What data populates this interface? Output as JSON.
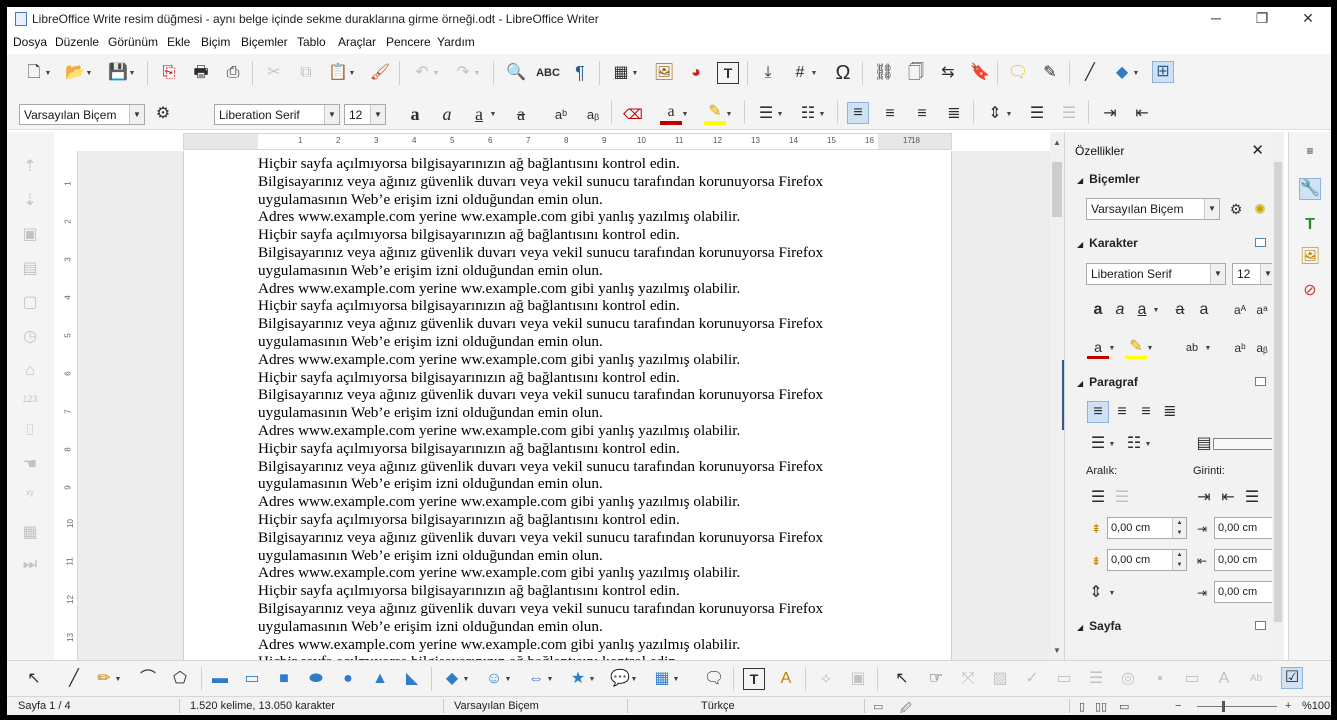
{
  "window": {
    "title": "LibreOffice Write resim düğmesi - aynı belge içinde sekme duraklarına girme örneği.odt - LibreOffice Writer",
    "minimize": "─",
    "maximize": "❐",
    "close": "✕"
  },
  "menu": [
    "Dosya",
    "Düzenle",
    "Görünüm",
    "Ekle",
    "Biçim",
    "Biçemler",
    "Tablo",
    "Araçlar",
    "Pencere",
    "Yardım"
  ],
  "formatting": {
    "paragraph_style": "Varsayılan Biçem",
    "font_name": "Liberation Serif",
    "font_size": "12"
  },
  "ruler": {
    "numbers": [
      "1",
      "2",
      "3",
      "4",
      "5",
      "6",
      "7",
      "8",
      "9",
      "10",
      "11",
      "12",
      "13",
      "14",
      "15",
      "16",
      "17",
      "18"
    ],
    "vertical_numbers": [
      "1",
      "2",
      "3",
      "4",
      "5",
      "6",
      "7",
      "8",
      "9",
      "10",
      "11",
      "12",
      "13"
    ]
  },
  "document": {
    "lines": [
      "Hiçbir sayfa açılmıyorsa bilgisayarınızın ağ bağlantısını kontrol edin.",
      "Bilgisayarınız veya ağınız güvenlik duvarı veya vekil sunucu tarafından korunuyorsa Firefox",
      "uygulamasının Web’e erişim izni olduğundan emin olun.",
      "Adres www.example.com yerine ww.example.com gibi yanlış yazılmış olabilir.",
      "Hiçbir sayfa açılmıyorsa bilgisayarınızın ağ bağlantısını kontrol edin.",
      "Bilgisayarınız veya ağınız güvenlik duvarı veya vekil sunucu tarafından korunuyorsa Firefox",
      "uygulamasının Web’e erişim izni olduğundan emin olun.",
      "Adres www.example.com yerine ww.example.com gibi yanlış yazılmış olabilir.",
      "Hiçbir sayfa açılmıyorsa bilgisayarınızın ağ bağlantısını kontrol edin.",
      "Bilgisayarınız veya ağınız güvenlik duvarı veya vekil sunucu tarafından korunuyorsa Firefox",
      "uygulamasının Web’e erişim izni olduğundan emin olun.",
      "Adres www.example.com yerine ww.example.com gibi yanlış yazılmış olabilir.",
      "Hiçbir sayfa açılmıyorsa bilgisayarınızın ağ bağlantısını kontrol edin.",
      "Bilgisayarınız veya ağınız güvenlik duvarı veya vekil sunucu tarafından korunuyorsa Firefox",
      "uygulamasının Web’e erişim izni olduğundan emin olun.",
      "Adres www.example.com yerine ww.example.com gibi yanlış yazılmış olabilir.",
      "Hiçbir sayfa açılmıyorsa bilgisayarınızın ağ bağlantısını kontrol edin.",
      "Bilgisayarınız veya ağınız güvenlik duvarı veya vekil sunucu tarafından korunuyorsa Firefox",
      "uygulamasının Web’e erişim izni olduğundan emin olun.",
      "Adres www.example.com yerine ww.example.com gibi yanlış yazılmış olabilir.",
      "Hiçbir sayfa açılmıyorsa bilgisayarınızın ağ bağlantısını kontrol edin.",
      "Bilgisayarınız veya ağınız güvenlik duvarı veya vekil sunucu tarafından korunuyorsa Firefox",
      "uygulamasının Web’e erişim izni olduğundan emin olun.",
      "Adres www.example.com yerine ww.example.com gibi yanlış yazılmış olabilir.",
      "Hiçbir sayfa açılmıyorsa bilgisayarınızın ağ bağlantısını kontrol edin.",
      "Bilgisayarınız veya ağınız güvenlik duvarı veya vekil sunucu tarafından korunuyorsa Firefox",
      "uygulamasının Web’e erişim izni olduğundan emin olun.",
      "Adres www.example.com yerine ww.example.com gibi yanlış yazılmış olabilir.",
      "Hiçbir sayfa açılmıyorsa bilgisayarınızın ağ bağlantısını kontrol edin."
    ]
  },
  "sidebar": {
    "title": "Özellikler",
    "close": "✕",
    "styles_section": "Biçemler",
    "style_value": "Varsayılan Biçem",
    "character_section": "Karakter",
    "font_name": "Liberation Serif",
    "font_size": "12",
    "paragraph_section": "Paragraf",
    "spacing_label": "Aralık:",
    "indent_label": "Girinti:",
    "above_spacing": "0,00 cm",
    "below_spacing": "0,00 cm",
    "before_indent": "0,00 cm",
    "after_indent": "0,00 cm",
    "first_line_indent": "0,00 cm",
    "page_section": "Sayfa"
  },
  "status": {
    "page": "Sayfa 1 / 4",
    "words": "1.520 kelime, 13.050 karakter",
    "style": "Varsayılan Biçem",
    "language": "Türkçe",
    "zoom": "%100"
  },
  "colors": {
    "accent": "#2f5d8c",
    "font_color_bar": "#c00000",
    "highlight_bar": "#ffff00"
  }
}
